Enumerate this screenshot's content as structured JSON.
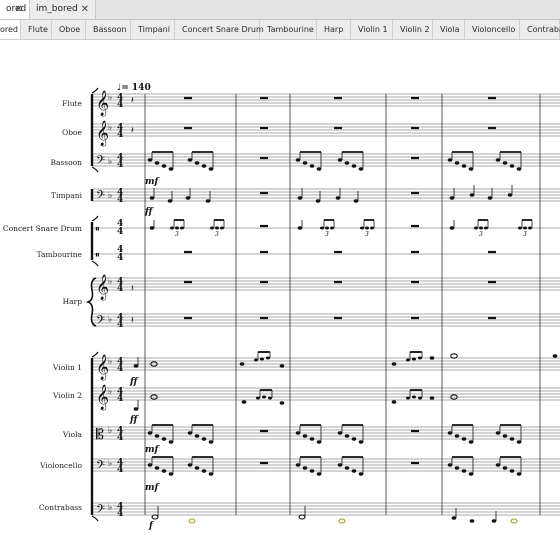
{
  "document_tabs": [
    {
      "label": "ored",
      "close": "✕",
      "active": true
    },
    {
      "label": "im_bored",
      "close": "✕",
      "active": false
    }
  ],
  "part_tabs": [
    "Flute",
    "Oboe",
    "Bassoon",
    "Timpani",
    "Concert Snare Drum",
    "Tambourine",
    "Harp",
    "Violin 1",
    "Violin 2",
    "Viola",
    "Violoncello",
    "Contrabass"
  ],
  "score": {
    "tempo_text": "♩= 140",
    "instruments": [
      "Flute",
      "Oboe",
      "Bassoon",
      "Timpani",
      "Concert Snare Drum",
      "Tambourine",
      "Harp",
      "Violin 1",
      "Violin 2",
      "Viola",
      "Violoncello",
      "Contrabass"
    ],
    "time_signature": {
      "top": "4",
      "bottom": "4"
    },
    "dynamics": {
      "bassoon": "mf",
      "timpani": "ff",
      "violin1": "ff",
      "violin2": "ff",
      "viola": "mf",
      "violoncello": "mf",
      "contrabass": "f"
    },
    "triplet_mark": "3"
  },
  "colors": {
    "tab_bar": "#e4e4e4",
    "active_tab": "#ffffff",
    "staff_lines": "#555555",
    "ink": "#111111"
  }
}
